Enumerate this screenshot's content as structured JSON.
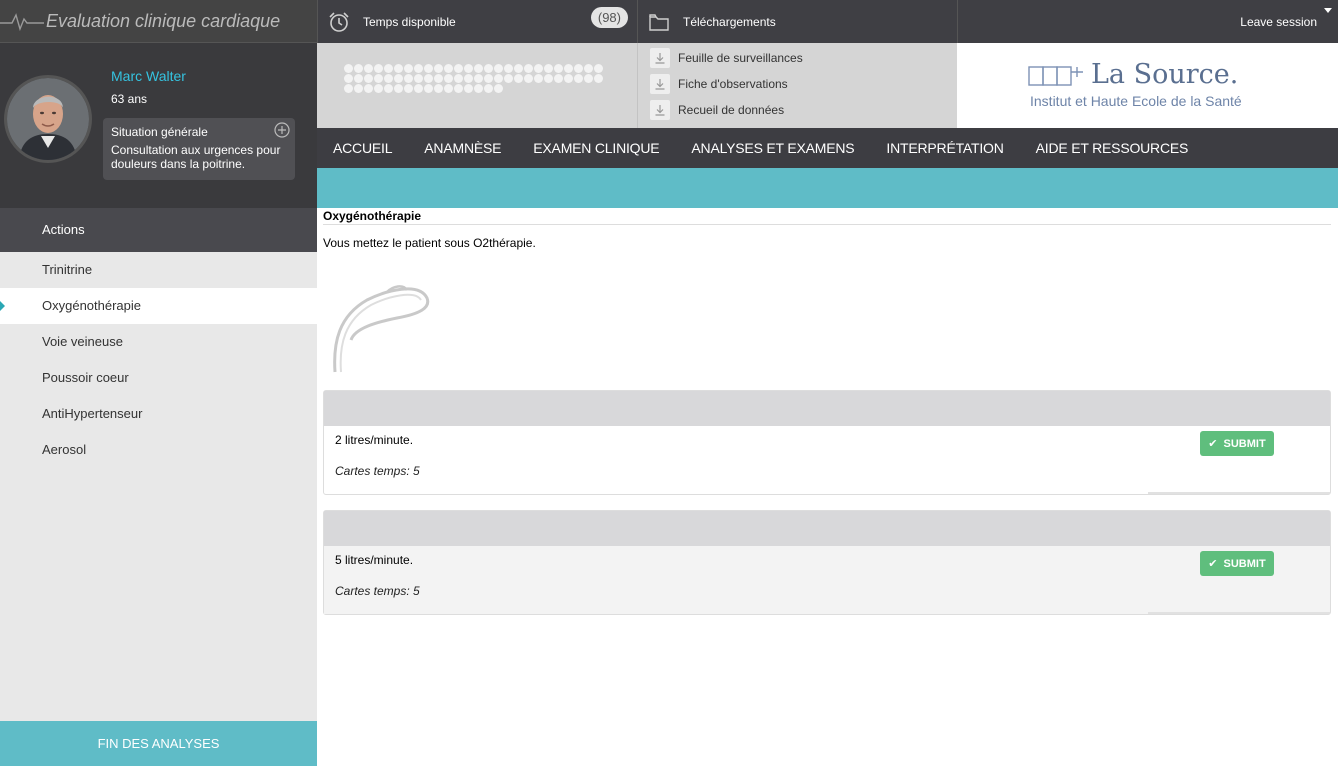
{
  "app": {
    "title": "Evaluation clinique cardiaque"
  },
  "timer": {
    "label": "Temps disponible",
    "count": "(98)",
    "dots": 68
  },
  "downloads": {
    "label": "Téléchargements",
    "items": [
      "Feuille de surveillances",
      "Fiche d'observations",
      "Recueil de données"
    ]
  },
  "session": {
    "leave_label": "Leave session"
  },
  "patient": {
    "name": "Marc Walter",
    "age": "63 ans",
    "situation_title": "Situation générale",
    "situation_text": "Consultation aux urgences pour douleurs dans la poitrine."
  },
  "logo": {
    "name": "La Source.",
    "subtitle": "Institut et Haute Ecole de la Santé"
  },
  "nav": [
    "ACCUEIL",
    "ANAMNÈSE",
    "EXAMEN CLINIQUE",
    "ANALYSES ET EXAMENS",
    "INTERPRÉTATION",
    "AIDE ET RESSOURCES"
  ],
  "sidebar": {
    "header": "Actions",
    "items": [
      "Trinitrine",
      "Oxygénothérapie",
      "Voie veineuse",
      "Poussoir coeur",
      "AntiHypertenseur",
      "Aerosol"
    ],
    "active_index": 1,
    "fin_label": "FIN DES ANALYSES"
  },
  "content": {
    "title": "Oxygénothérapie",
    "description": "Vous mettez le patient sous O2thérapie.",
    "options": [
      {
        "text": "2 litres/minute.",
        "meta": "Cartes temps: 5",
        "submit": "SUBMIT"
      },
      {
        "text": "5 litres/minute.",
        "meta": "Cartes temps: 5",
        "submit": "SUBMIT"
      }
    ]
  },
  "colors": {
    "accent_teal": "#5fbcc7",
    "name_blue": "#35c3e0",
    "submit_green": "#5fbe7d",
    "dark_bar": "#3d3d42"
  }
}
